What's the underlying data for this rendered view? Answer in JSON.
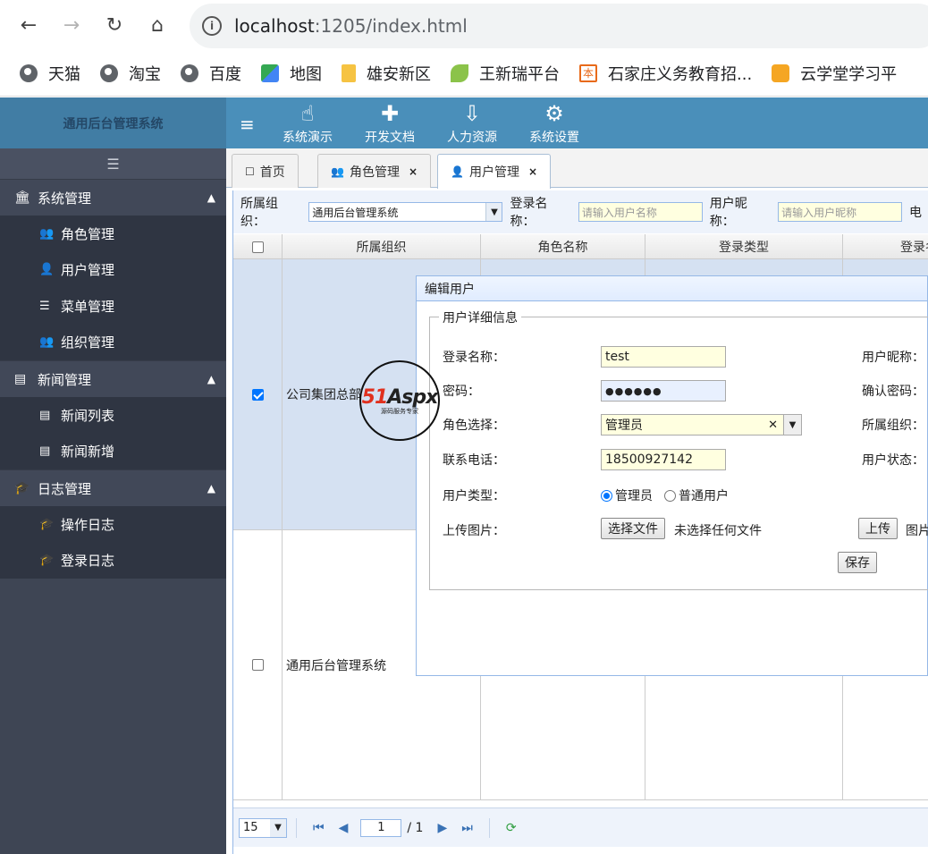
{
  "browser": {
    "url_host": "localhost",
    "url_rest": ":1205/index.html",
    "bookmarks": [
      "天猫",
      "淘宝",
      "百度",
      "地图",
      "雄安新区",
      "王新瑞平台",
      "石家庄义务教育招...",
      "云学堂学习平"
    ]
  },
  "app": {
    "brand": "通用后台管理系统",
    "top_menu": [
      {
        "label": "系统演示",
        "icon": "hand-pointer-icon"
      },
      {
        "label": "开发文档",
        "icon": "puzzle-icon"
      },
      {
        "label": "人力资源",
        "icon": "sort-icon"
      },
      {
        "label": "系统设置",
        "icon": "gear-icon"
      }
    ]
  },
  "sidebar": {
    "groups": [
      {
        "label": "系统管理",
        "items": [
          "角色管理",
          "用户管理",
          "菜单管理",
          "组织管理"
        ]
      },
      {
        "label": "新闻管理",
        "items": [
          "新闻列表",
          "新闻新增"
        ]
      },
      {
        "label": "日志管理",
        "items": [
          "操作日志",
          "登录日志"
        ]
      }
    ]
  },
  "tabs": [
    {
      "label": "首页"
    },
    {
      "label": "角色管理"
    },
    {
      "label": "用户管理"
    }
  ],
  "toolbar": {
    "org_label": "所属组织：",
    "org_value": "通用后台管理系统",
    "login_label": "登录名称：",
    "login_placeholder": "请输入用户名称",
    "nick_label": "用户昵称：",
    "nick_placeholder": "请输入用户昵称",
    "more_label": "电"
  },
  "grid": {
    "headers": [
      "所属组织",
      "角色名称",
      "登录类型",
      "登录名"
    ],
    "rows": [
      {
        "org": "公司集团总部",
        "checked": true
      },
      {
        "org": "通用后台管理系统",
        "checked": false
      }
    ]
  },
  "pager": {
    "page_size": "15",
    "page": "1",
    "total": "/ 1"
  },
  "dialog": {
    "title": "编辑用户",
    "legend": "用户详细信息",
    "login_name_label": "登录名称：",
    "login_name_value": "test",
    "nickname_label": "用户昵称：",
    "password_label": "密码：",
    "password_value": "●●●●●●",
    "confirm_label": "确认密码：",
    "role_label": "角色选择：",
    "role_value": "管理员",
    "org_label": "所属组织：",
    "phone_label": "联系电话：",
    "phone_value": "18500927142",
    "status_label": "用户状态：",
    "type_label": "用户类型：",
    "type_admin": "管理员",
    "type_normal": "普通用户",
    "upload_label": "上传图片：",
    "choose_file": "选择文件",
    "no_file": "未选择任何文件",
    "upload_btn": "上传",
    "image_label": "图片",
    "save_btn": "保存"
  },
  "watermark": {
    "brand_red": "51",
    "brand_black": "Aspx",
    "sub": "源码服务专家"
  }
}
